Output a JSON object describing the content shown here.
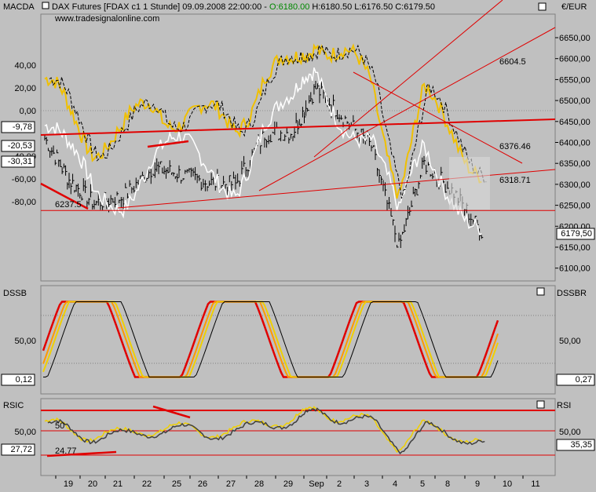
{
  "header": {
    "instrument": "DAX Futures [FDAX c1  1 Stunde] 09.09.2008 22:00:00 - ",
    "open": "O:6180.00",
    "hlc": " H:6180.50 L:6176.50 C:6179.50",
    "watermark": "www.tradesignalonline.com"
  },
  "panes": {
    "main": {
      "left_title": "MACDA",
      "right_title": "€/EUR",
      "left_ticks": [
        "40,00",
        "20,00",
        "0,00",
        "-40,00",
        "-60,00",
        "-80,00"
      ],
      "left_badges": [
        "-9,78",
        "-20,53",
        "-30,31"
      ],
      "right_ticks": [
        "6650,00",
        "6600,00",
        "6550,00",
        "6500,00",
        "6450,00",
        "6400,00",
        "6350,00",
        "6300,00",
        "6250,00",
        "6200,00",
        "6150,00",
        "6100,00"
      ],
      "price_badge": "6179,50",
      "annotations": [
        "6604.5",
        "6376.46",
        "6318.71",
        "6237.5"
      ]
    },
    "dssb": {
      "left_title": "DSSB",
      "right_title": "DSSBR",
      "left_tick": "50,00",
      "right_tick": "50,00",
      "left_badge": "0,12",
      "right_badge": "0,27"
    },
    "rsic": {
      "left_title": "RSIC",
      "right_title": "RSI",
      "left_tick": "50,00",
      "right_tick": "50,00",
      "left_badge": "27,72",
      "right_badge": "35,35",
      "annotations": [
        "50",
        "24.77"
      ]
    }
  },
  "xaxis": {
    "labels": [
      "19",
      "20",
      "21",
      "22",
      "25",
      "26",
      "27",
      "28",
      "29",
      "Sep",
      "2",
      "3",
      "4",
      "5",
      "8",
      "9",
      "10",
      "11"
    ]
  },
  "colors": {
    "background": "#c0c0c0",
    "price": "#000000",
    "macd": "#f0c000",
    "macd_signal": "#000000",
    "white_line": "#ffffff",
    "trend": "#e00000",
    "dss_fast": "#e00000",
    "dss_orange": "#ff9900",
    "dss_yellow": "#f0d000"
  },
  "chart_data": {
    "type": "line",
    "title": "DAX Futures [FDAX c1  1 Stunde] 09.09.2008 22:00:00",
    "x": [
      "19",
      "20",
      "21",
      "22",
      "25",
      "26",
      "27",
      "28",
      "29",
      "Sep",
      "2",
      "3",
      "4",
      "5",
      "8",
      "9",
      "10",
      "11"
    ],
    "ylabel": "€/EUR",
    "ylim": [
      6100,
      6650
    ],
    "series": [
      {
        "values": [
          6410,
          6310,
          6255,
          6270,
          6340,
          6325,
          6305,
          6300,
          6420,
          6425,
          6530,
          6460,
          6390,
          6150,
          6350,
          6280,
          6179.5,
          null
        ]
      }
    ],
    "levels": [
      6604.5,
      6376.46,
      6318.71,
      6237.5
    ],
    "macd_ylim": [
      -80,
      40
    ],
    "dss_ylim": [
      0,
      100
    ],
    "rsi_ylim": [
      0,
      100
    ],
    "rsi_lines": [
      50,
      24.77
    ]
  }
}
